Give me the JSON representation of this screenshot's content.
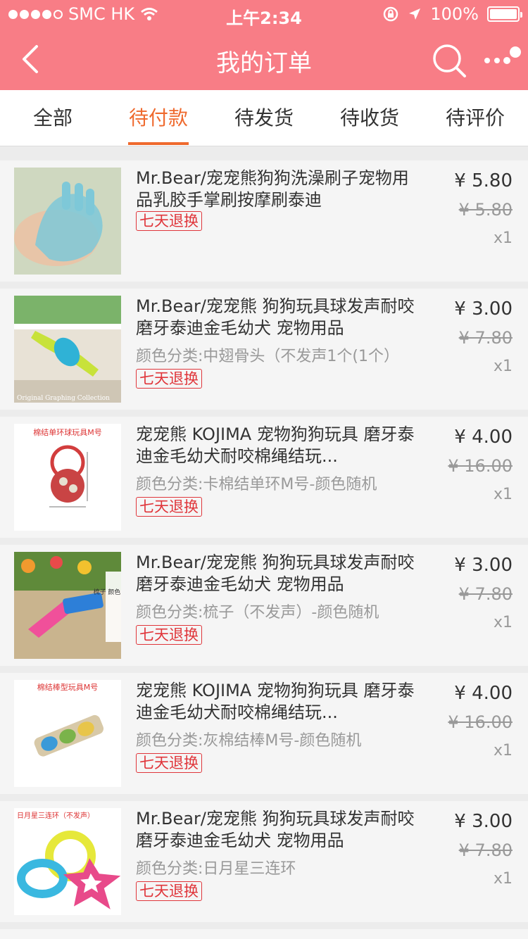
{
  "status_bar": {
    "carrier": "SMC HK",
    "time": "上午2:34",
    "battery": "100%"
  },
  "nav": {
    "title": "我的订单"
  },
  "tabs": [
    {
      "label": "全部",
      "active": false
    },
    {
      "label": "待付款",
      "active": true
    },
    {
      "label": "待发货",
      "active": false
    },
    {
      "label": "待收货",
      "active": false
    },
    {
      "label": "待评价",
      "active": false
    }
  ],
  "items": [
    {
      "title": "Mr.Bear/宠宠熊狗狗洗澡刷子宠物用品乳胶手掌刷按摩刷泰迪",
      "sku": "",
      "badge": "七天退换",
      "price": "¥ 5.80",
      "original_price": "¥ 5.80",
      "qty": "x1"
    },
    {
      "title": "Mr.Bear/宠宠熊 狗狗玩具球发声耐咬磨牙泰迪金毛幼犬 宠物用品",
      "sku": "颜色分类:中翅骨头（不发声1个(1个）",
      "badge": "七天退换",
      "price": "¥ 3.00",
      "original_price": "¥ 7.80",
      "qty": "x1",
      "thumb_text": "Original Graphing Collection"
    },
    {
      "title": "宠宠熊 KOJIMA 宠物狗狗玩具 磨牙泰迪金毛幼犬耐咬棉绳结玩...",
      "sku": "颜色分类:卡棉结单环M号-颜色随机",
      "badge": "七天退换",
      "price": "¥ 4.00",
      "original_price": "¥ 16.00",
      "qty": "x1",
      "thumb_text": "棉结单环球玩具M号"
    },
    {
      "title": "Mr.Bear/宠宠熊 狗狗玩具球发声耐咬磨牙泰迪金毛幼犬 宠物用品",
      "sku": "颜色分类:梳子（不发声）-颜色随机",
      "badge": "七天退换",
      "price": "¥ 3.00",
      "original_price": "¥ 7.80",
      "qty": "x1",
      "thumb_text": "梳子 颜色随机"
    },
    {
      "title": "宠宠熊 KOJIMA 宠物狗狗玩具 磨牙泰迪金毛幼犬耐咬棉绳结玩...",
      "sku": "颜色分类:灰棉结棒M号-颜色随机",
      "badge": "七天退换",
      "price": "¥ 4.00",
      "original_price": "¥ 16.00",
      "qty": "x1",
      "thumb_text": "棉结棒型玩具M号"
    },
    {
      "title": "Mr.Bear/宠宠熊 狗狗玩具球发声耐咬磨牙泰迪金毛幼犬 宠物用品",
      "sku": "颜色分类:日月星三连环",
      "badge": "七天退换",
      "price": "¥ 3.00",
      "original_price": "¥ 7.80",
      "qty": "x1",
      "thumb_text": "日月星三连环（不发声）"
    }
  ],
  "colors": {
    "header": "#f87d86",
    "accent": "#ef6a2e",
    "badge": "#e0363b"
  }
}
